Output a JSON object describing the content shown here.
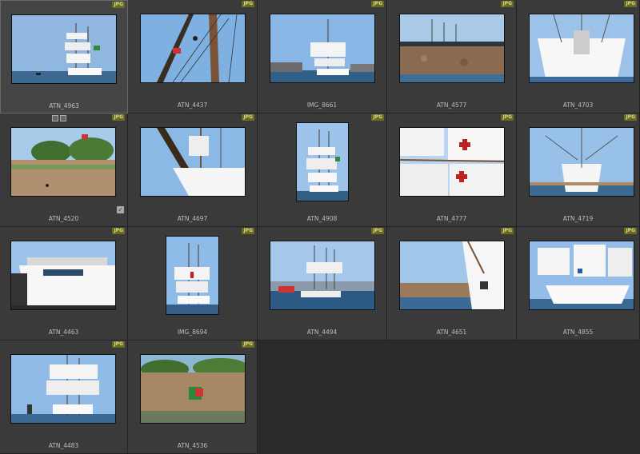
{
  "badge_label": "JPG",
  "check_glyph": "✓",
  "icons": [
    "gray-square-icon",
    "edit-pencil-icon",
    "checkbox-icon"
  ],
  "photos": [
    {
      "name": "ATN_4963"
    },
    {
      "name": "ATN_4437"
    },
    {
      "name": "IMG_8661"
    },
    {
      "name": "ATN_4577"
    },
    {
      "name": "ATN_4703"
    },
    {
      "name": "ATN_4520"
    },
    {
      "name": "ATN_4697"
    },
    {
      "name": "ATN_4908"
    },
    {
      "name": "ATN_4777"
    },
    {
      "name": "ATN_4719"
    },
    {
      "name": "ATN_4463"
    },
    {
      "name": "IMG_8694"
    },
    {
      "name": "ATN_4494"
    },
    {
      "name": "ATN_4651"
    },
    {
      "name": "ATN_4855"
    },
    {
      "name": "ATN_4483"
    },
    {
      "name": "ATN_4536"
    }
  ]
}
